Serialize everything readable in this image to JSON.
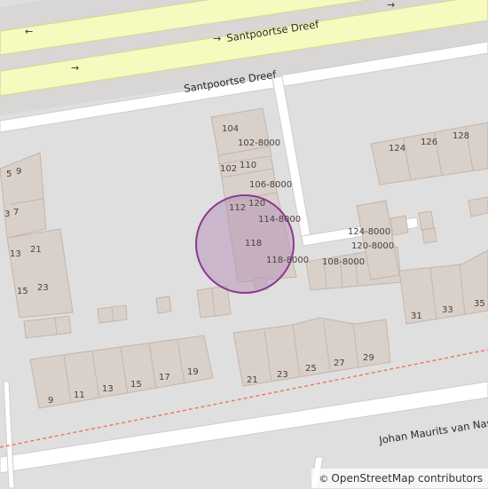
{
  "map": {
    "colors": {
      "landuse": "#e0dfdf",
      "road_fill": "#ffffff",
      "road_casing": "#c9c6c6",
      "main_road": "#f7fabf",
      "building_fill": "#d9d0c9",
      "building_stroke": "#c4b6ab",
      "marker_fill": "#b38fb8",
      "marker_stroke": "#8a3b8f",
      "boundary": "#ee7261"
    },
    "streets": {
      "santpoortse_dreef_1": "Santpoortse Dreef",
      "santpoortse_dreef_2": "Santpoortse Dreef",
      "johan_maurits": "Johan Maurits van Nas"
    },
    "oneway_arrow": "→",
    "oneway_arrow_back": "←",
    "house_numbers": {
      "n104": "104",
      "n102_8000": "102-8000",
      "n102": "102",
      "n110": "110",
      "n106_8000": "106-8000",
      "n112": "112",
      "n120": "120",
      "n114_8000": "114-8000",
      "n118": "118",
      "n118_8000": "118-8000",
      "n124_8000": "124-8000",
      "n120_8000": "120-8000",
      "n108_8000": "108-8000",
      "n124": "124",
      "n126": "126",
      "n128": "128",
      "n5": "5",
      "n9": "9",
      "n3": "3",
      "n7": "7",
      "n13": "13",
      "n21": "21",
      "n15": "15",
      "n23": "23",
      "n31": "31",
      "n33": "33",
      "n35": "35",
      "s9": "9",
      "s11": "11",
      "s13": "13",
      "s15": "15",
      "s17": "17",
      "s19": "19",
      "s21": "21",
      "s23": "23",
      "s25": "25",
      "s27": "27",
      "s29": "29"
    },
    "attribution": {
      "symbol": "©",
      "text": "OpenStreetMap contributors"
    }
  }
}
